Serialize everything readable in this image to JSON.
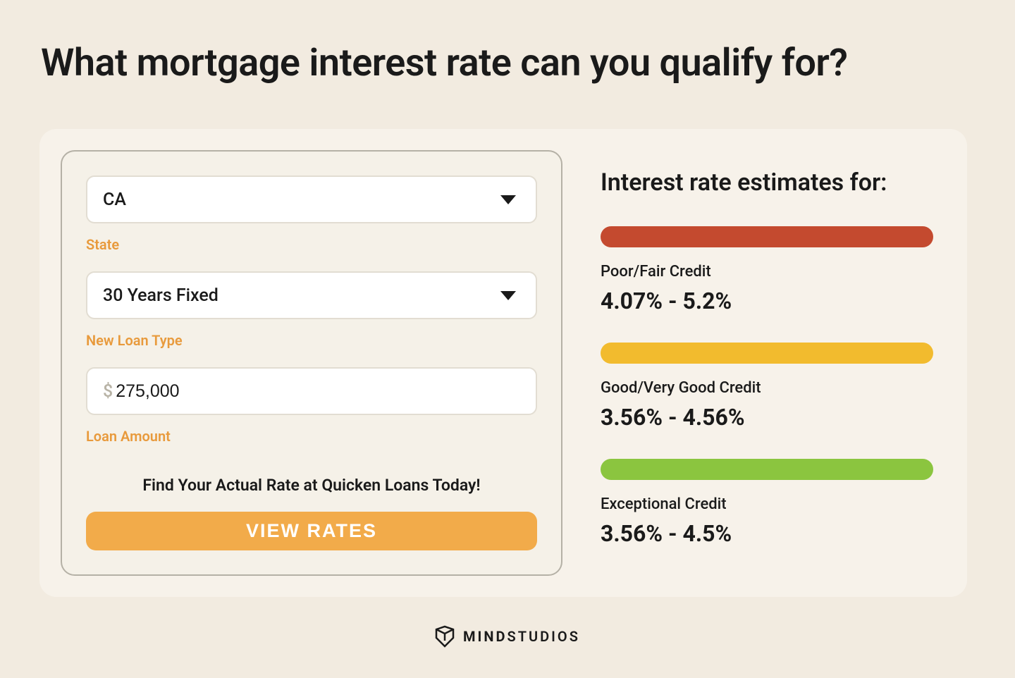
{
  "page": {
    "title": "What mortgage interest rate can you qualify for?"
  },
  "form": {
    "state": {
      "value": "CA",
      "label": "State"
    },
    "loanType": {
      "value": "30 Years Fixed",
      "label": "New Loan Type"
    },
    "loanAmount": {
      "currency": "$",
      "value": "275,000",
      "label": "Loan Amount"
    },
    "ctaText": "Find Your Actual Rate at Quicken Loans Today!",
    "buttonLabel": "VIEW RATES"
  },
  "results": {
    "title": "Interest rate estimates for:",
    "items": [
      {
        "label": "Poor/Fair Credit",
        "value": "4.07% - 5.2%",
        "color": "red"
      },
      {
        "label": "Good/Very Good Credit",
        "value": "3.56% - 4.56%",
        "color": "yellow"
      },
      {
        "label": "Exceptional Credit",
        "value": "3.56% - 4.5%",
        "color": "green"
      }
    ]
  },
  "footer": {
    "brandBold": "MIND",
    "brandLight": "STUDIOS"
  }
}
